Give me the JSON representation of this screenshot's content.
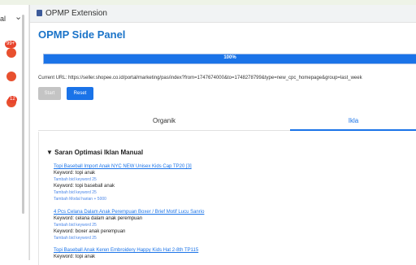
{
  "left": {
    "select_label": "al",
    "badges": [
      "99+",
      "12"
    ]
  },
  "header": {
    "title": "OPMP Extension"
  },
  "panel": {
    "title": "OPMP Side Panel",
    "progress": {
      "percent_label": "100%",
      "value": 1.0
    },
    "current_url": "Current URL: https://seller.shopee.co.id/portal/marketing/pas/index?from=1747674000&to=1748278799&type=new_cpc_homepage&group=last_week",
    "buttons": {
      "start": "Start",
      "reset": "Reset"
    },
    "tabs": [
      "Organik",
      "Ikla"
    ],
    "section_title": "▼  Saran Optimasi Iklan Manual",
    "items": [
      {
        "link": "Topi Baseball Import Anak NYC NEW Unisex Kids Cap TP20 [3]",
        "lines": [
          {
            "kind": "kw",
            "text": "Keyword: topi anak"
          },
          {
            "kind": "sub",
            "text": "Tambah bid keyword 25"
          },
          {
            "kind": "kw",
            "text": "Keyword: topi baseball anak"
          },
          {
            "kind": "sub",
            "text": "Tambah bid keyword 25"
          },
          {
            "kind": "sub",
            "text": "Tambah Modal harian + 5000"
          }
        ]
      },
      {
        "link": "4 Pcs Celana Dalam Anak Perempuan Boxer / Brief Motif Lucu Sanrio",
        "lines": [
          {
            "kind": "kw",
            "text": "Keyword: celana dalam anak perempuan"
          },
          {
            "kind": "sub",
            "text": "Tambah bid keyword 25"
          },
          {
            "kind": "kw",
            "text": "Keyword: boxer anak perempuan"
          },
          {
            "kind": "sub",
            "text": "Tambah bid keyword 25"
          }
        ]
      },
      {
        "link": "Topi Baseball Anak Keren Embroidery Happy Kids Hat 2-8th TP115",
        "lines": [
          {
            "kind": "kw",
            "text": "Keyword: topi anak"
          }
        ]
      }
    ]
  }
}
